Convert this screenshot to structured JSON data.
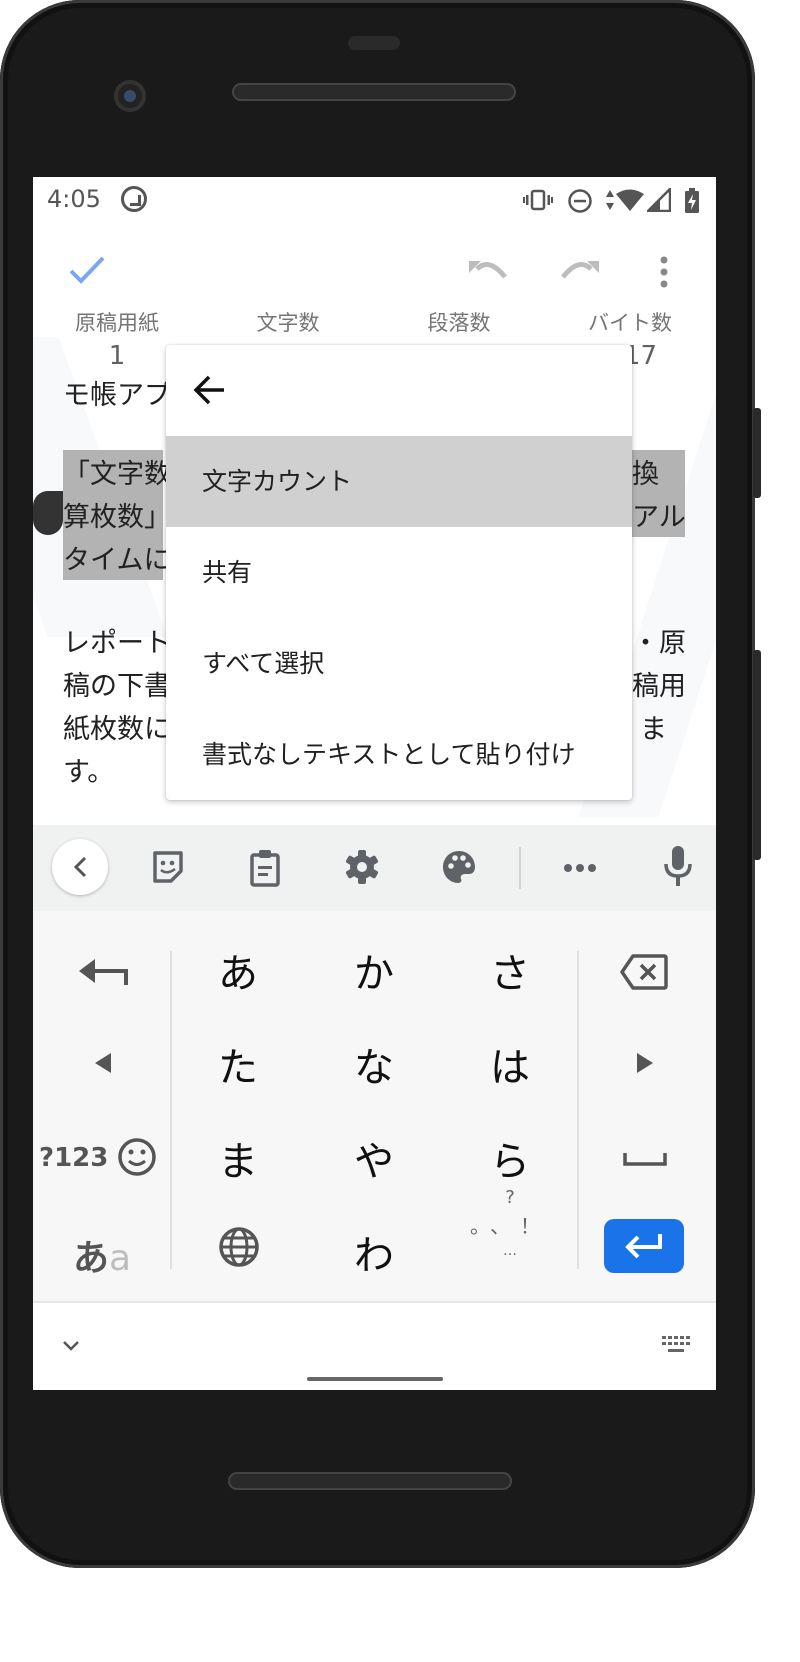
{
  "status_bar": {
    "time": "4:05",
    "icons": [
      "q-notification-icon",
      "vibrate-icon",
      "do-not-disturb-icon",
      "data-arrows-icon",
      "wifi-icon",
      "cell-signal-icon",
      "battery-charging-icon"
    ]
  },
  "app_bar": {
    "icons": [
      "check-icon",
      "undo-icon",
      "redo-icon",
      "more-vert-icon"
    ]
  },
  "stats": [
    {
      "label": "原稿用紙",
      "value": "1"
    },
    {
      "label": "文字数",
      "value": ""
    },
    {
      "label": "段落数",
      "value": ""
    },
    {
      "label": "バイト数",
      "value": "17"
    }
  ],
  "document": {
    "line1_left": "モ帳アプ",
    "para1": [
      {
        "left": "「文字数",
        "right": "換"
      },
      {
        "left": "算枚数」",
        "right": "アル"
      },
      {
        "left": "タイムに",
        "right": ""
      }
    ],
    "para2": [
      {
        "left": "レポート",
        "right": "・原"
      },
      {
        "left": "稿の下書",
        "right": "稿用"
      },
      {
        "left": "紙枚数に",
        "right": "ま"
      },
      {
        "left": "す。",
        "right": ""
      }
    ]
  },
  "context_menu": {
    "back_icon": "arrow-back-icon",
    "items": [
      {
        "label": "文字カウント",
        "highlighted": true
      },
      {
        "label": "共有",
        "highlighted": false
      },
      {
        "label": "すべて選択",
        "highlighted": false
      },
      {
        "label": "書式なしテキストとして貼り付け",
        "highlighted": false
      }
    ]
  },
  "keyboard": {
    "toolbar_icons": [
      "chevron-left-icon",
      "sticker-icon",
      "clipboard-icon",
      "settings-icon",
      "theme-palette-icon",
      "more-horiz-icon",
      "microphone-icon"
    ],
    "rows": [
      [
        "あ",
        "か",
        "さ"
      ],
      [
        "た",
        "な",
        "は"
      ],
      [
        "ま",
        "や",
        "ら"
      ],
      [
        "",
        "わ",
        ""
      ]
    ],
    "symbols_label": "?123",
    "mode_label_primary": "あ",
    "mode_label_secondary": "a",
    "punct_top": "?",
    "punct_main": "。、！",
    "punct_small": [
      "。",
      "、",
      "！"
    ],
    "punct_bottom": "…",
    "accent_color": "#1a73e8"
  },
  "nav": {
    "hide_keyboard_icon": "chevron-down-icon",
    "keyboard_switch_icon": "keyboard-icon"
  }
}
